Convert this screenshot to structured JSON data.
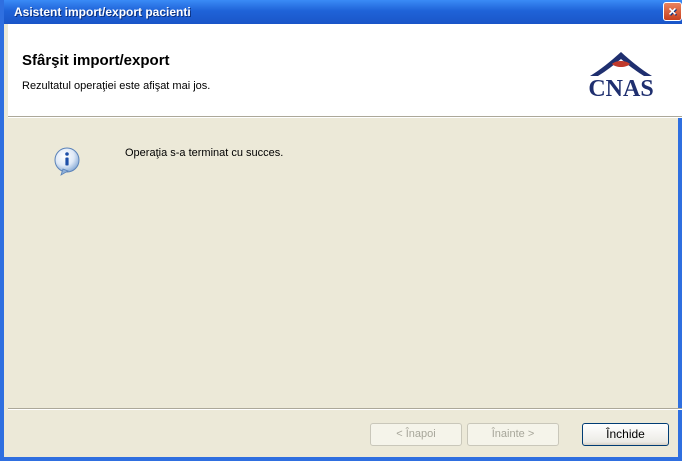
{
  "window": {
    "title": "Asistent import/export pacienti",
    "close_symbol": "×"
  },
  "header": {
    "title": "Sfârşit import/export",
    "subtitle": "Rezultatul operaţiei este afişat mai jos.",
    "logo_text": "CNAS"
  },
  "content": {
    "message": "Operaţia s-a terminat cu succes.",
    "icon": "info-icon"
  },
  "footer": {
    "back_label": "< Înapoi",
    "next_label": "Înainte >",
    "close_label": "Închide"
  },
  "colors": {
    "titlebar": "#1f63d8",
    "window_bg": "#ece9d8",
    "logo": "#1f2f6f",
    "logo_accent": "#c0392b"
  }
}
